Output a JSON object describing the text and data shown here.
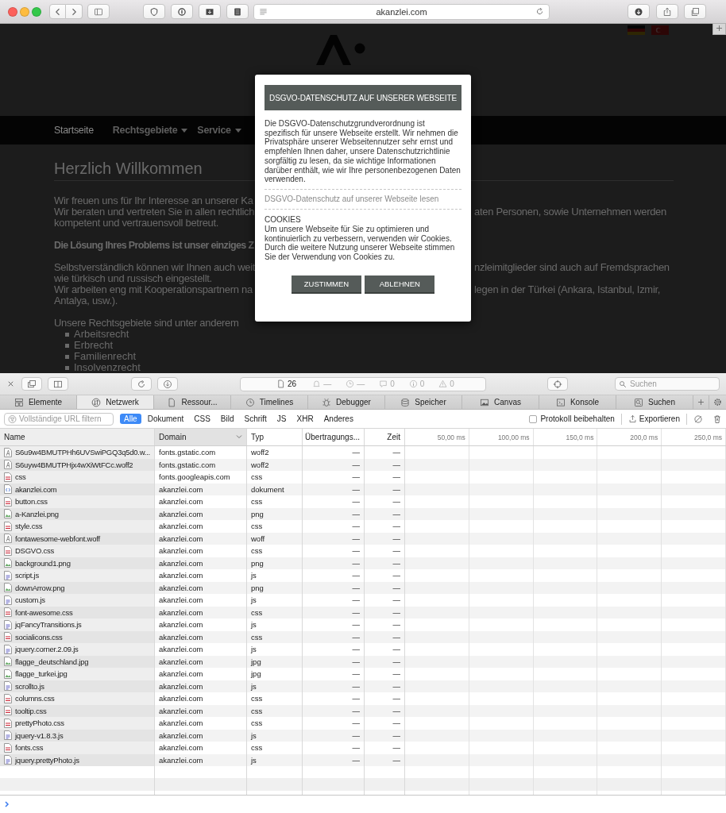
{
  "browser": {
    "address": "akanzlei.com"
  },
  "website": {
    "nav": [
      {
        "label": "Startseite",
        "selected": true,
        "has_menu": false
      },
      {
        "label": "Rechtsgebiete",
        "selected": false,
        "has_menu": true
      },
      {
        "label": "Service",
        "selected": false,
        "has_menu": true
      }
    ],
    "heading": "Herzlich Willkommen",
    "paragraphs": [
      {
        "bold": false,
        "lines": [
          {
            "left": "Wir freuen uns für Ihr Interesse an unserer Ka"
          },
          {
            "left": "Wir beraten und vertreten Sie in allen rechtlich",
            "right": "aten Personen, sowie Unternehmen werden"
          },
          {
            "left": "kompetent und vertrauensvoll betreut."
          }
        ]
      },
      {
        "bold": true,
        "lines": [
          {
            "left": "Die Lösung Ihres Problems ist unser einziges Z"
          }
        ]
      },
      {
        "bold": false,
        "lines": [
          {
            "left": "Selbstverständlich können wir Ihnen auch weit",
            "right": "nzleimitglieder sind auch auf Fremdsprachen"
          },
          {
            "left": "wie türkisch und russisch eingestellt."
          },
          {
            "left": "Wir arbeiten eng mit Kooperationspartnern na",
            "right": "legen in der Türkei (Ankara, Istanbul, Izmir,"
          },
          {
            "left": "Antalya, usw.)."
          }
        ]
      },
      {
        "bold": false,
        "lines": [
          {
            "left": "Unsere Rechtsgebiete sind unter anderem"
          }
        ]
      }
    ],
    "list": [
      "Arbeitsrecht",
      "Erbrecht",
      "Familienrecht",
      "Insolvenzrecht"
    ]
  },
  "modal": {
    "title": "DSGVO-DATENSCHUTZ AUF UNSERER WEBSEITE",
    "intro": "Die DSGVO-Datenschutzgrundverordnung ist spezifisch für unsere Webseite erstellt. Wir nehmen die Privatsphäre unserer Webseitennutzer sehr ernst und empfehlen Ihnen daher, unsere Datenschutzrichtlinie sorgfältig zu lesen, da sie wichtige Informationen darüber enthält, wie wir Ihre personenbezogenen Daten verwenden.",
    "link": "DSGVO-Datenschutz auf unserer Webseite lesen",
    "cookies_heading": "COOKIES",
    "cookies_text": "Um unsere Webseite für Sie zu optimieren und kontinuierlich zu verbessern, verwenden wir Cookies. Durch die weitere Nutzung unserer Webseite stimmen Sie der Verwendung von Cookies zu.",
    "buttons": [
      "ZUSTIMMEN",
      "ABLEHNEN"
    ]
  },
  "devtools": {
    "status": [
      {
        "kind": "resources",
        "value": "26",
        "active": true
      },
      {
        "kind": "notifications",
        "value": "—",
        "active": false
      },
      {
        "kind": "time",
        "value": "—",
        "active": false
      },
      {
        "kind": "logs",
        "value": "0",
        "active": false
      },
      {
        "kind": "info",
        "value": "0",
        "active": false
      },
      {
        "kind": "warnings",
        "value": "0",
        "active": false
      }
    ],
    "search_placeholder": "Suchen",
    "tabs": [
      {
        "kind": "elements",
        "label": "Elemente",
        "selected": false
      },
      {
        "kind": "network",
        "label": "Netzwerk",
        "selected": true
      },
      {
        "kind": "resources",
        "label": "Ressour...",
        "selected": false
      },
      {
        "kind": "timelines",
        "label": "Timelines",
        "selected": false
      },
      {
        "kind": "debugger",
        "label": "Debugger",
        "selected": false
      },
      {
        "kind": "storage",
        "label": "Speicher",
        "selected": false
      },
      {
        "kind": "canvas",
        "label": "Canvas",
        "selected": false
      },
      {
        "kind": "console",
        "label": "Konsole",
        "selected": false
      },
      {
        "kind": "search",
        "label": "Suchen",
        "selected": false
      }
    ],
    "filter_placeholder": "Vollständige URL filtern",
    "filters": [
      {
        "label": "Alle",
        "selected": true
      },
      {
        "label": "Dokument",
        "selected": false
      },
      {
        "label": "CSS",
        "selected": false
      },
      {
        "label": "Bild",
        "selected": false
      },
      {
        "label": "Schrift",
        "selected": false
      },
      {
        "label": "JS",
        "selected": false
      },
      {
        "label": "XHR",
        "selected": false
      },
      {
        "label": "Anderes",
        "selected": false
      }
    ],
    "preserve_log": {
      "label": "Protokoll beibehalten",
      "checked": false
    },
    "export_label": "Exportieren",
    "columns": [
      {
        "label": "Name",
        "sorted": false
      },
      {
        "label": "Domain",
        "sorted": true
      },
      {
        "label": "Typ",
        "sorted": false
      },
      {
        "label": "Übertragungs...",
        "sorted": false
      },
      {
        "label": "Zeit",
        "sorted": false
      }
    ],
    "timeline_ticks": [
      "50,00 ms",
      "100,00 ms",
      "150,0 ms",
      "200,0 ms",
      "250,0 ms"
    ],
    "rows": [
      {
        "kind": "font",
        "name": "S6u9w4BMUTPHh6UVSwiPGQ3q5d0.w...",
        "domain": "fonts.gstatic.com",
        "type": "woff2",
        "transfer": "—",
        "time": "—"
      },
      {
        "kind": "font",
        "name": "S6uyw4BMUTPHjx4wXiWtFCc.woff2",
        "domain": "fonts.gstatic.com",
        "type": "woff2",
        "transfer": "—",
        "time": "—"
      },
      {
        "kind": "css",
        "name": "css",
        "domain": "fonts.googleapis.com",
        "type": "css",
        "transfer": "—",
        "time": "—"
      },
      {
        "kind": "document",
        "name": "akanzlei.com",
        "domain": "akanzlei.com",
        "type": "dokument",
        "transfer": "—",
        "time": "—"
      },
      {
        "kind": "css",
        "name": "button.css",
        "domain": "akanzlei.com",
        "type": "css",
        "transfer": "—",
        "time": "—"
      },
      {
        "kind": "image",
        "name": "a-Kanzlei.png",
        "domain": "akanzlei.com",
        "type": "png",
        "transfer": "—",
        "time": "—"
      },
      {
        "kind": "css",
        "name": "style.css",
        "domain": "akanzlei.com",
        "type": "css",
        "transfer": "—",
        "time": "—"
      },
      {
        "kind": "font",
        "name": "fontawesome-webfont.woff",
        "domain": "akanzlei.com",
        "type": "woff",
        "transfer": "—",
        "time": "—"
      },
      {
        "kind": "css",
        "name": "DSGVO.css",
        "domain": "akanzlei.com",
        "type": "css",
        "transfer": "—",
        "time": "—"
      },
      {
        "kind": "image",
        "name": "background1.png",
        "domain": "akanzlei.com",
        "type": "png",
        "transfer": "—",
        "time": "—"
      },
      {
        "kind": "script",
        "name": "script.js",
        "domain": "akanzlei.com",
        "type": "js",
        "transfer": "—",
        "time": "—"
      },
      {
        "kind": "image",
        "name": "downArrow.png",
        "domain": "akanzlei.com",
        "type": "png",
        "transfer": "—",
        "time": "—"
      },
      {
        "kind": "script",
        "name": "custom.js",
        "domain": "akanzlei.com",
        "type": "js",
        "transfer": "—",
        "time": "—"
      },
      {
        "kind": "css",
        "name": "font-awesome.css",
        "domain": "akanzlei.com",
        "type": "css",
        "transfer": "—",
        "time": "—"
      },
      {
        "kind": "script",
        "name": "jqFancyTransitions.js",
        "domain": "akanzlei.com",
        "type": "js",
        "transfer": "—",
        "time": "—"
      },
      {
        "kind": "css",
        "name": "socialicons.css",
        "domain": "akanzlei.com",
        "type": "css",
        "transfer": "—",
        "time": "—"
      },
      {
        "kind": "script",
        "name": "jquery.corner.2.09.js",
        "domain": "akanzlei.com",
        "type": "js",
        "transfer": "—",
        "time": "—"
      },
      {
        "kind": "image",
        "name": "flagge_deutschland.jpg",
        "domain": "akanzlei.com",
        "type": "jpg",
        "transfer": "—",
        "time": "—"
      },
      {
        "kind": "image",
        "name": "flagge_turkei.jpg",
        "domain": "akanzlei.com",
        "type": "jpg",
        "transfer": "—",
        "time": "—"
      },
      {
        "kind": "script",
        "name": "scrollto.js",
        "domain": "akanzlei.com",
        "type": "js",
        "transfer": "—",
        "time": "—"
      },
      {
        "kind": "css",
        "name": "columns.css",
        "domain": "akanzlei.com",
        "type": "css",
        "transfer": "—",
        "time": "—"
      },
      {
        "kind": "css",
        "name": "tooltip.css",
        "domain": "akanzlei.com",
        "type": "css",
        "transfer": "—",
        "time": "—"
      },
      {
        "kind": "css",
        "name": "prettyPhoto.css",
        "domain": "akanzlei.com",
        "type": "css",
        "transfer": "—",
        "time": "—"
      },
      {
        "kind": "script",
        "name": "jquery-v1.8.3.js",
        "domain": "akanzlei.com",
        "type": "js",
        "transfer": "—",
        "time": "—"
      },
      {
        "kind": "css",
        "name": "fonts.css",
        "domain": "akanzlei.com",
        "type": "css",
        "transfer": "—",
        "time": "—"
      },
      {
        "kind": "script",
        "name": "jquery.prettyPhoto.js",
        "domain": "akanzlei.com",
        "type": "js",
        "transfer": "—",
        "time": "—"
      }
    ]
  }
}
